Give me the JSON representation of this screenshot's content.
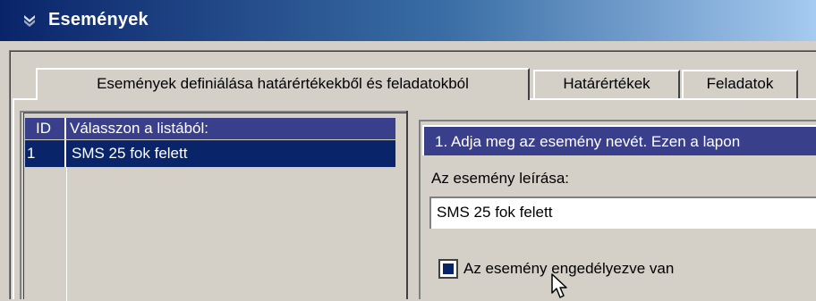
{
  "window": {
    "title": "Események",
    "title_icon": "window-icon"
  },
  "tabs": [
    {
      "label": "Események definiálása határértékekből és feladatokból",
      "active": true
    },
    {
      "label": "Határértékek",
      "active": false
    },
    {
      "label": "Feladatok",
      "active": false
    }
  ],
  "list": {
    "columns": [
      "ID",
      "Válasszon a listából:"
    ],
    "rows": [
      {
        "id": "1",
        "name": "SMS 25 fok felett",
        "selected": true
      }
    ]
  },
  "step": {
    "header": "1. Adja meg az esemény nevét. Ezen a lapon"
  },
  "form": {
    "description_label": "Az esemény leírása:",
    "description_value": "SMS 25 fok felett",
    "enabled_label": "Az esemény engedélyezve van",
    "enabled_checked": true
  },
  "colors": {
    "title_gradient_start": "#0a246a",
    "header_bg": "#3a3f8c",
    "selection_bg": "#0a246a",
    "face": "#d4d0c8"
  }
}
